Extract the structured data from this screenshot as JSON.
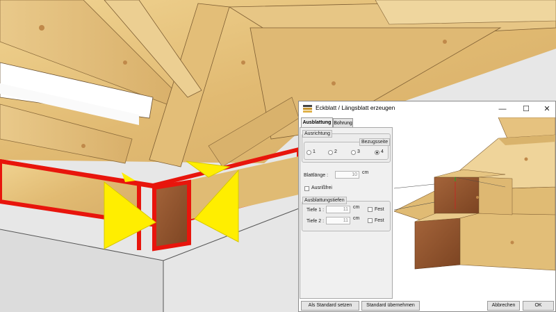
{
  "dialog": {
    "title": "Eckblatt / Längsblatt erzeugen",
    "window_controls": {
      "minimize": "—",
      "maximize": "☐",
      "close": "✕"
    },
    "tabs": [
      {
        "label": "Ausblattung",
        "active": true
      },
      {
        "label": "Bohrung",
        "active": false
      }
    ],
    "ausrichtung": {
      "group_label": "Ausrichtung",
      "bezugsseite_label": "Bezugsseite",
      "options": [
        "1",
        "2",
        "3",
        "4"
      ],
      "selected": "4"
    },
    "blattlaenge": {
      "label": "Blattlänge :",
      "value": "10",
      "unit": "cm"
    },
    "ausriss": {
      "label": "Ausrißfrei",
      "checked": false
    },
    "ausblattungstiefen": {
      "group_label": "Ausblattungstiefen",
      "tiefe1": {
        "label": "Tiefe 1 :",
        "value": "11",
        "unit": "cm",
        "fest_label": "Fest",
        "fest_checked": false
      },
      "tiefe2": {
        "label": "Tiefe 2 :",
        "value": "11",
        "unit": "cm",
        "fest_label": "Fest",
        "fest_checked": false
      }
    },
    "buttons": {
      "als_standard": "Als Standard setzen",
      "standard_uebernehmen": "Standard übernehmen",
      "abbrechen": "Abbrechen",
      "ok": "OK"
    }
  },
  "colors": {
    "highlight_red": "#e8150c",
    "highlight_yellow": "#ffee00",
    "wood_light": "#e8c580",
    "wood_end_grain": "#9a5a2c"
  }
}
